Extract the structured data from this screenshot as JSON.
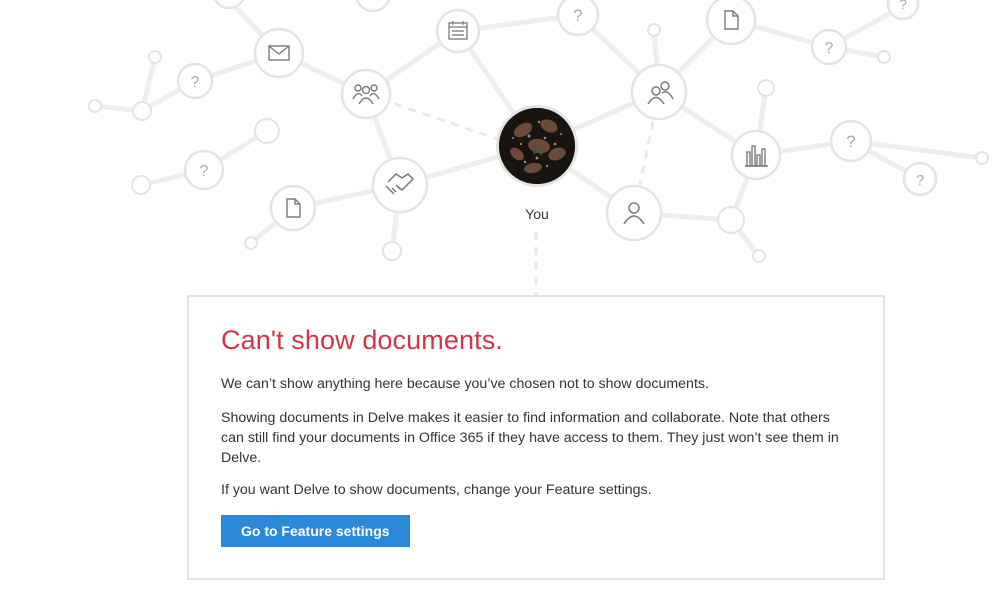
{
  "profile": {
    "you_label": "You"
  },
  "graph": {
    "question_mark": "?"
  },
  "message": {
    "title": "Can't show documents.",
    "paragraph_1": "We can’t show anything here because you’ve chosen not to show documents.",
    "paragraph_2": "Showing documents in Delve makes it easier to find information and collaborate. Note that others can still find your documents in Office 365 if they have access to them. They just won’t see them in Delve.",
    "paragraph_3": "If you want Delve to show documents, change your Feature settings.",
    "button_label": "Go to Feature settings"
  },
  "colors": {
    "title": "#d63343",
    "button": "#2b88d8",
    "node_stroke": "#e4e4e4",
    "icon": "#7a7a7a"
  }
}
